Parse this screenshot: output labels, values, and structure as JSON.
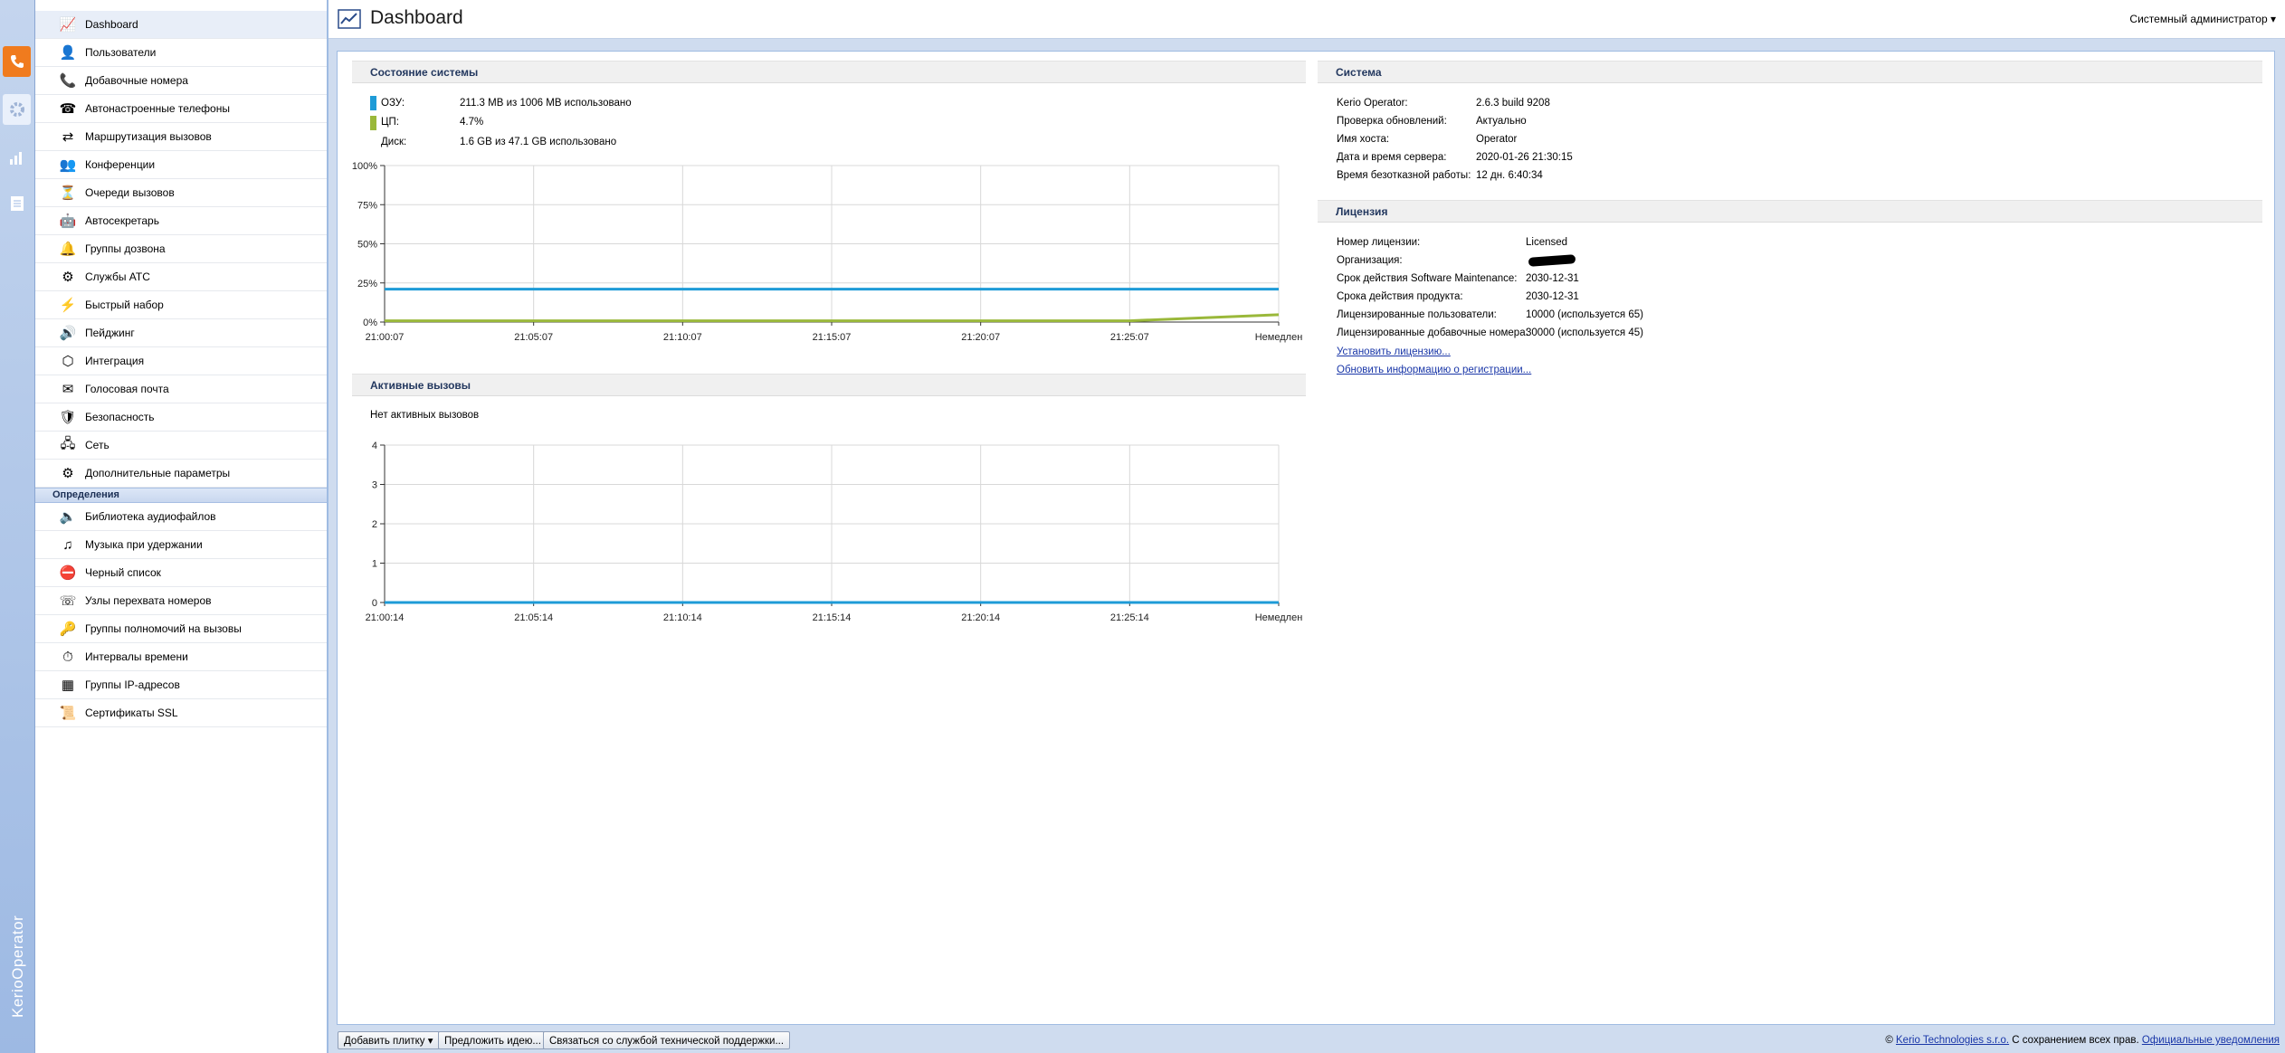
{
  "app": {
    "brand": "KerioOperator"
  },
  "header": {
    "title": "Dashboard",
    "user_menu": "Системный администратор"
  },
  "nav": {
    "main": [
      {
        "label": "Dashboard",
        "icon": "dashboard-icon",
        "active": true
      },
      {
        "label": "Пользователи",
        "icon": "user-icon"
      },
      {
        "label": "Добавочные номера",
        "icon": "handset-icon"
      },
      {
        "label": "Автонастроенные телефоны",
        "icon": "phone-icon"
      },
      {
        "label": "Маршрутизация вызовов",
        "icon": "routing-icon"
      },
      {
        "label": "Конференции",
        "icon": "conference-icon"
      },
      {
        "label": "Очереди вызовов",
        "icon": "queue-icon"
      },
      {
        "label": "Автосекретарь",
        "icon": "autoattendant-icon"
      },
      {
        "label": "Группы дозвона",
        "icon": "ring-group-icon"
      },
      {
        "label": "Службы АТС",
        "icon": "pbx-services-icon"
      },
      {
        "label": "Быстрый набор",
        "icon": "lightning-icon"
      },
      {
        "label": "Пейджинг",
        "icon": "speaker-icon"
      },
      {
        "label": "Интеграция",
        "icon": "integration-icon"
      },
      {
        "label": "Голосовая почта",
        "icon": "voicemail-icon"
      },
      {
        "label": "Безопасность",
        "icon": "security-icon"
      },
      {
        "label": "Сеть",
        "icon": "network-icon"
      },
      {
        "label": "Дополнительные параметры",
        "icon": "advanced-settings-icon"
      }
    ],
    "group_title": "Определения",
    "definitions": [
      {
        "label": "Библиотека аудиофайлов",
        "icon": "audio-library-icon"
      },
      {
        "label": "Музыка при удержании",
        "icon": "music-note-icon"
      },
      {
        "label": "Черный список",
        "icon": "blacklist-icon"
      },
      {
        "label": "Узлы перехвата номеров",
        "icon": "call-pickup-icon"
      },
      {
        "label": "Группы полномочий на вызовы",
        "icon": "call-permissions-icon"
      },
      {
        "label": "Интервалы времени",
        "icon": "time-intervals-icon"
      },
      {
        "label": "Группы IP-адресов",
        "icon": "ip-groups-icon"
      },
      {
        "label": "Сертификаты SSL",
        "icon": "certificate-icon"
      }
    ]
  },
  "system_status": {
    "title": "Состояние системы",
    "rows": [
      {
        "label": "ОЗУ:",
        "value": "211.3 MB из 1006 MB использовано",
        "color": "#1e9bd7"
      },
      {
        "label": "ЦП:",
        "value": "4.7%",
        "color": "#9ab83a"
      },
      {
        "label": "Диск:",
        "value": "1.6 GB из 47.1 GB использовано"
      }
    ]
  },
  "active_calls": {
    "title": "Активные вызовы",
    "empty_text": "Нет активных вызовов"
  },
  "system": {
    "title": "Система",
    "rows": [
      {
        "label": "Kerio Operator:",
        "value": "2.6.3 build 9208"
      },
      {
        "label": "Проверка обновлений:",
        "value": "Актуально"
      },
      {
        "label": "Имя хоста:",
        "value": "Operator"
      },
      {
        "label": "Дата и время сервера:",
        "value": "2020-01-26 21:30:15"
      },
      {
        "label": "Время безотказной работы:",
        "value": "12 дн. 6:40:34"
      }
    ]
  },
  "license": {
    "title": "Лицензия",
    "rows": [
      {
        "label": "Номер лицензии:",
        "value": "Licensed"
      },
      {
        "label": "Организация:",
        "value": ""
      },
      {
        "label": "Срок действия Software Maintenance:",
        "value": "2030-12-31"
      },
      {
        "label": "Срока действия продукта:",
        "value": "2030-12-31"
      },
      {
        "label": "Лицензированные пользователи:",
        "value": "10000 (используется 65)"
      },
      {
        "label": "Лицензированные добавочные номера:",
        "value": "30000 (используется 45)"
      }
    ],
    "links": [
      "Установить лицензию...",
      "Обновить информацию о регистрации..."
    ]
  },
  "footer": {
    "buttons": [
      "Добавить плитку",
      "Предложить идею...",
      "Связаться со службой технической поддержки..."
    ],
    "copyright_symbol": "©",
    "company_link": "Kerio Technologies s.r.o.",
    "rights": "С сохранением всех прав.",
    "notices_link": "Официальные уведомления"
  },
  "chart_data": [
    {
      "type": "line",
      "x": [
        "21:00:07",
        "21:05:07",
        "21:10:07",
        "21:15:07",
        "21:20:07",
        "21:25:07",
        "Немедлен"
      ],
      "yticks": [
        "0%",
        "25%",
        "50%",
        "75%",
        "100%"
      ],
      "ylim": [
        0,
        100
      ],
      "grid": true,
      "series": [
        {
          "name": "ОЗУ",
          "color": "#1e9bd7",
          "values": [
            21,
            21,
            21,
            21,
            21,
            21,
            21
          ]
        },
        {
          "name": "ЦП",
          "color": "#9ab83a",
          "values": [
            0.8,
            0.8,
            0.8,
            0.8,
            0.8,
            0.8,
            4.7
          ]
        }
      ]
    },
    {
      "type": "line",
      "x": [
        "21:00:14",
        "21:05:14",
        "21:10:14",
        "21:15:14",
        "21:20:14",
        "21:25:14",
        "Немедлен"
      ],
      "yticks": [
        "0",
        "1",
        "2",
        "3",
        "4"
      ],
      "ylim": [
        0,
        4
      ],
      "grid": true,
      "series": [
        {
          "color": "#1e9bd7",
          "values": [
            0,
            0,
            0,
            0,
            0,
            0,
            0
          ]
        }
      ]
    }
  ]
}
